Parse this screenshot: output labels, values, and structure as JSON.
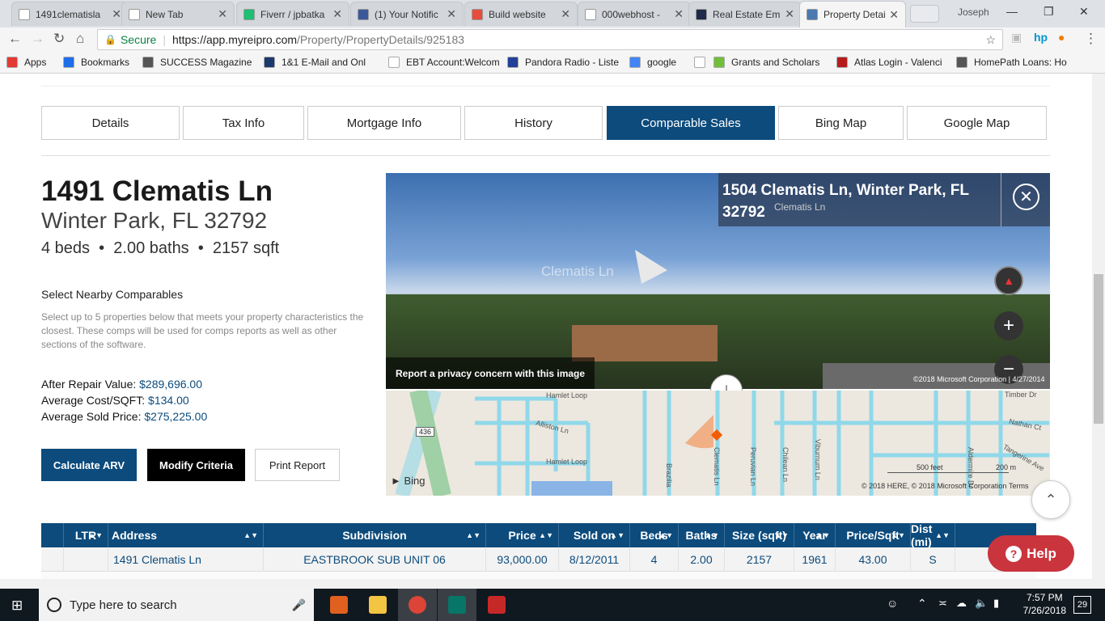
{
  "browser": {
    "tabs": [
      {
        "title": "1491clematisla",
        "color": "#ffffff"
      },
      {
        "title": "New Tab",
        "color": "#ffffff"
      },
      {
        "title": "Fiverr / jpbatka",
        "color": "#1dbf73"
      },
      {
        "title": "(1) Your Notific",
        "color": "#3b5998"
      },
      {
        "title": "Build website",
        "color": "#e84c3d"
      },
      {
        "title": "000webhost - ",
        "color": "#ffffff"
      },
      {
        "title": "Real Estate Em",
        "color": "#1e2a4a"
      },
      {
        "title": "Property Detail",
        "color": "#4a7ab0"
      }
    ],
    "profile": "Joseph",
    "secure_label": "Secure",
    "url_base": "https://app.myreipro.com",
    "url_path": "/Property/PropertyDetails/925183",
    "bookmarks": [
      {
        "label": "Apps",
        "color": "#e53935"
      },
      {
        "label": "Bookmarks",
        "color": "#1e6ee8"
      },
      {
        "label": "SUCCESS Magazine",
        "color": "#555555"
      },
      {
        "label": "1&1 E-Mail and Onl",
        "color": "#1b3a6b"
      },
      {
        "label": "EBT Account:Welcom",
        "color": "#ffffff"
      },
      {
        "label": "Pandora Radio - Liste",
        "color": "#224099"
      },
      {
        "label": "google",
        "color": "#4285f4"
      },
      {
        "label": "",
        "color": "#ffffff"
      },
      {
        "label": "Grants and Scholars",
        "color": "#6fbf3a"
      },
      {
        "label": "Atlas Login - Valenci",
        "color": "#b71c1c"
      },
      {
        "label": "HomePath Loans: Ho",
        "color": "#555555"
      }
    ]
  },
  "nav_tabs": [
    {
      "label": "Details",
      "active": false
    },
    {
      "label": "Tax Info",
      "active": false
    },
    {
      "label": "Mortgage Info",
      "active": false
    },
    {
      "label": "History",
      "active": false
    },
    {
      "label": "Comparable Sales",
      "active": true
    },
    {
      "label": "Bing Map",
      "active": false
    },
    {
      "label": "Google Map",
      "active": false
    }
  ],
  "property": {
    "street": "1491 Clematis Ln",
    "city_line": "Winter Park, FL 32792",
    "specs": "4 beds  •  2.00 baths  •  2157 sqft"
  },
  "comparables": {
    "heading": "Select Nearby Comparables",
    "description": "Select up to 5 properties below that meets your property characteristics the closest. These comps will be used for comps reports as well as other sections of the software.",
    "stats": [
      {
        "label": "After Repair Value:",
        "value": "$289,696.00"
      },
      {
        "label": "Average Cost/SQFT:",
        "value": "$134.00"
      },
      {
        "label": "Average Sold Price:",
        "value": "$275,225.00"
      }
    ],
    "buttons": {
      "calc": "Calculate ARV",
      "modify": "Modify Criteria",
      "print": "Print Report"
    }
  },
  "streetside": {
    "address": "1504 Clematis Ln, Winter Park, FL 32792",
    "street_overlay": "Clematis Ln",
    "street_label": "Clematis Ln",
    "privacy": "Report a privacy concern with this image",
    "copyright": "©2018 Microsoft Corporation | 4/27/2014"
  },
  "map": {
    "labels": [
      "Hamlet Loop",
      "Alliston Ln",
      "Hamlet Loop",
      "436",
      "Clematis Ln",
      "Peruvian Ln",
      "Chilean Ln",
      "Viburnum Ln",
      "Nathan Ct",
      "Timber Dr",
      "Tangerine Ave",
      "Aldermire Dr",
      "Brazilia"
    ],
    "scale_feet": "500 feet",
    "scale_m": "200 m",
    "copyright": "© 2018 HERE, © 2018 Microsoft Corporation",
    "terms": "Terms",
    "brand": "Bing"
  },
  "table": {
    "columns": [
      "",
      "LTR",
      "Address",
      "Subdivision",
      "Price",
      "Sold on",
      "Beds",
      "Baths",
      "Size (sqft)",
      "Year",
      "Price/Sqft",
      "Dist (mi)"
    ],
    "rows": [
      [
        "",
        "",
        "1491 Clematis Ln",
        "EASTBROOK SUB UNIT 06",
        "93,000.00",
        "8/12/2011",
        "4",
        "2.00",
        "2157",
        "1961",
        "43.00",
        "S"
      ]
    ]
  },
  "help_label": "Help",
  "taskbar": {
    "search_placeholder": "Type here to search",
    "time": "7:57 PM",
    "date": "7/26/2018",
    "notifications": "29"
  }
}
